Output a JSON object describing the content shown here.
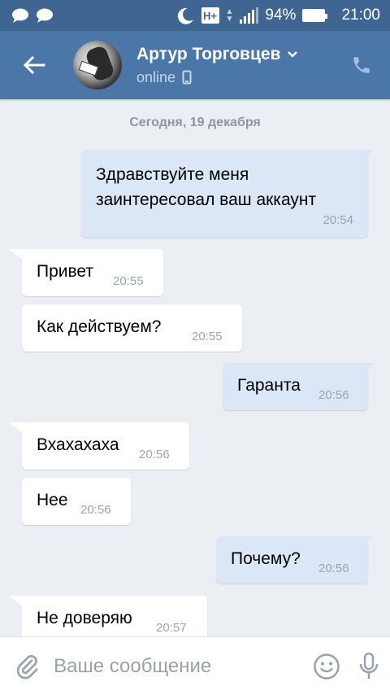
{
  "status_bar": {
    "battery_percent": "94%",
    "time": "21:00",
    "network_label": "H+",
    "icons": [
      "chat-bubble-icon",
      "chat-bubble-icon",
      "moon-icon",
      "network-icon",
      "signal-icon",
      "battery-icon"
    ]
  },
  "header": {
    "contact_name": "Артур Торговцев",
    "status": "online",
    "icons": [
      "back-arrow-icon",
      "chevron-down-icon",
      "mobile-phone-icon",
      "phone-call-icon"
    ]
  },
  "chat": {
    "date_separator": "Сегодня, 19 декабря",
    "messages": [
      {
        "direction": "out",
        "text_line1": "Здравствуйте меня",
        "text_line2": "заинтересовал ваш аккаунт",
        "time": "20:54"
      },
      {
        "direction": "in",
        "text": "Привет",
        "time": "20:55"
      },
      {
        "direction": "in",
        "text": "Как действуем?",
        "time": "20:55"
      },
      {
        "direction": "out",
        "text": "Гаранта",
        "time": "20:56"
      },
      {
        "direction": "in",
        "text": "Вхахахаха",
        "time": "20:56"
      },
      {
        "direction": "in",
        "text": "Нее",
        "time": "20:56"
      },
      {
        "direction": "out",
        "text": "Почему?",
        "time": "20:56"
      },
      {
        "direction": "in",
        "text": "Не доверяю",
        "time": "20:57"
      }
    ]
  },
  "composer": {
    "placeholder": "Ваше сообщение",
    "icons": [
      "paperclip-icon",
      "emoji-icon",
      "microphone-icon"
    ]
  },
  "colors": {
    "header": "#4a76a8",
    "status_bar": "#3f6592",
    "background": "#ebeef2",
    "incoming_bubble": "#ffffff",
    "outgoing_bubble": "#dbe7f6"
  }
}
